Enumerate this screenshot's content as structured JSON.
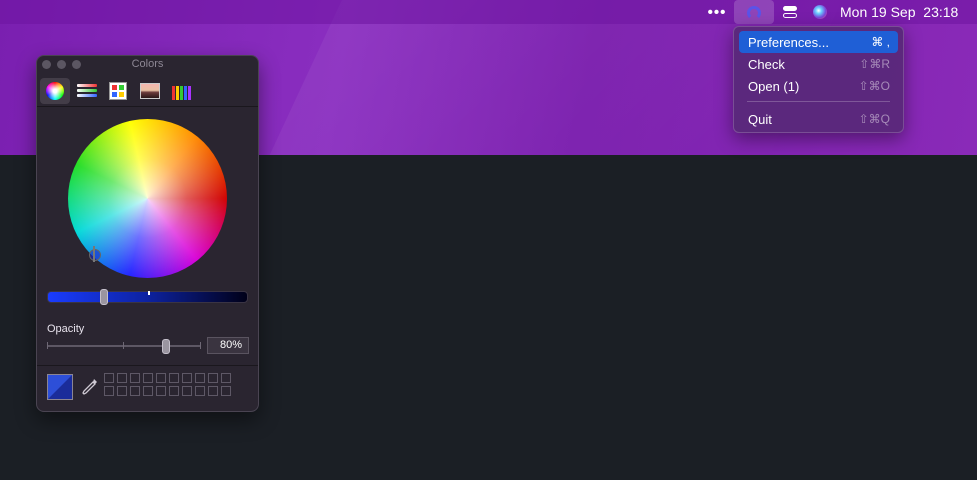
{
  "menubar": {
    "overflow_icon": "ellipsis-icon",
    "app_icon": "headset-icon",
    "control_center_icon": "control-center-icon",
    "siri_icon": "siri-icon",
    "date": "Mon 19 Sep",
    "time": "23:18"
  },
  "menu": {
    "items": [
      {
        "label": "Preferences...",
        "shortcut": "⌘ ,",
        "selected": true
      },
      {
        "label": "Check",
        "shortcut": "⇧⌘R"
      },
      {
        "label": "Open (1)",
        "shortcut": "⇧⌘O"
      },
      {
        "label": "Quit",
        "shortcut": "⇧⌘Q"
      }
    ]
  },
  "colors_panel": {
    "title": "Colors",
    "tabs": [
      "color-wheel-icon",
      "color-sliders-icon",
      "color-palettes-icon",
      "image-palettes-icon",
      "pencils-icon"
    ],
    "active_tab": "color-wheel-icon",
    "brightness_fraction": 0.27,
    "opacity_label": "Opacity",
    "opacity_value": "80%",
    "current_color": "#2d4fd8",
    "swatch_slots": 20
  },
  "colors": {
    "selection": "#1f5fd6",
    "wallpaper": "#7a1fb0",
    "desktop": "#1b1f25"
  }
}
